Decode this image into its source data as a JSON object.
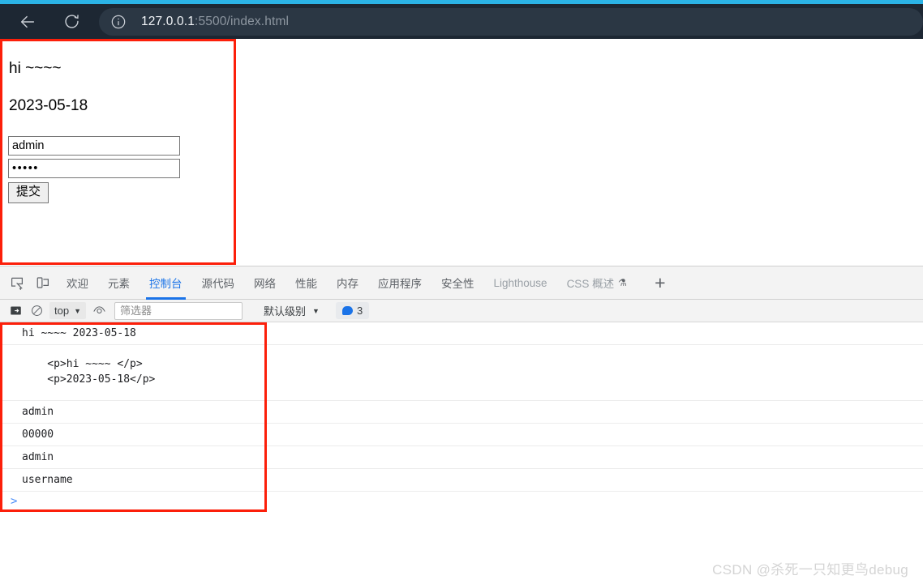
{
  "browser": {
    "back_icon": "back-arrow-icon",
    "reload_icon": "reload-icon",
    "info_icon": "info-circle-icon",
    "url_host": "127.0.0.1",
    "url_rest": ":5500/index.html",
    "url_full": "127.0.0.1:5500/index.html"
  },
  "page": {
    "heading": "hi ~~~~",
    "date": "2023-05-18",
    "username_value": "admin",
    "username_placeholder": "",
    "password_value": "•••••",
    "password_placeholder": "",
    "submit_label": "提交"
  },
  "devtools": {
    "inspect_icon": "inspect-element-icon",
    "device_icon": "device-toolbar-icon",
    "tabs": [
      {
        "label": "欢迎",
        "active": false,
        "dim": false
      },
      {
        "label": "元素",
        "active": false,
        "dim": false
      },
      {
        "label": "控制台",
        "active": true,
        "dim": false
      },
      {
        "label": "源代码",
        "active": false,
        "dim": false
      },
      {
        "label": "网络",
        "active": false,
        "dim": false
      },
      {
        "label": "性能",
        "active": false,
        "dim": false
      },
      {
        "label": "内存",
        "active": false,
        "dim": false
      },
      {
        "label": "应用程序",
        "active": false,
        "dim": false
      },
      {
        "label": "安全性",
        "active": false,
        "dim": false
      },
      {
        "label": "Lighthouse",
        "active": false,
        "dim": true
      },
      {
        "label": "CSS 概述",
        "active": false,
        "dim": true,
        "icon": "flask-icon"
      }
    ],
    "add_tab_label": "+",
    "console_toolbar": {
      "sidebar_icon": "console-sidebar-icon",
      "clear_icon": "clear-console-icon",
      "context_value": "top",
      "eye_icon": "live-expression-icon",
      "filter_placeholder": "筛选器",
      "filter_value": "",
      "levels_label": "默认级别",
      "message_count": "3",
      "message_icon": "speech-bubble-icon"
    },
    "console_messages": [
      {
        "text": "hi ~~~~ 2023-05-18",
        "tall": false
      },
      {
        "text": "    <p>hi ~~~~ </p>\n    <p>2023-05-18</p>",
        "tall": true
      },
      {
        "text": "admin",
        "tall": false
      },
      {
        "text": "00000",
        "tall": false
      },
      {
        "text": "admin",
        "tall": false
      },
      {
        "text": "username",
        "tall": false
      }
    ],
    "prompt_chevron": ">"
  },
  "annotations": {
    "page_box_color": "#fc1f0a",
    "console_box_color": "#fc1f0a"
  },
  "watermark": "CSDN @杀死一只知更鸟debug"
}
